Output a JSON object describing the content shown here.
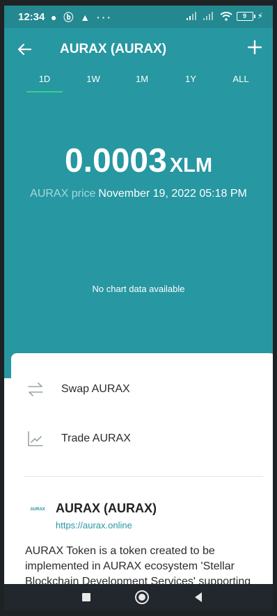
{
  "status_bar": {
    "time": "12:34",
    "left_icons": "● ⓑ ▲ ···",
    "battery": "9"
  },
  "app_bar": {
    "title": "AURAX (AURAX)",
    "back_icon": "arrow-left-icon",
    "add_icon": "plus-icon"
  },
  "range_tabs": [
    {
      "label": "1D",
      "active": true
    },
    {
      "label": "1W",
      "active": false
    },
    {
      "label": "1M",
      "active": false
    },
    {
      "label": "1Y",
      "active": false
    },
    {
      "label": "ALL",
      "active": false
    }
  ],
  "price": {
    "value": "0.0003",
    "unit": "XLM",
    "label": "AURAX price",
    "date": "November 19, 2022 05:18 PM"
  },
  "chart": {
    "empty_message": "No chart data available"
  },
  "actions": [
    {
      "label": "Swap AURAX",
      "icon": "swap-icon"
    },
    {
      "label": "Trade AURAX",
      "icon": "trade-chart-icon"
    }
  ],
  "token": {
    "logo_text": "AURAX",
    "name": "AURAX (AURAX)",
    "link": "https://aurax.online",
    "description": "AURAX Token is a token created to be implemented in AURAX ecosystem 'Stellar Blockchain Development Services' supporting"
  },
  "colors": {
    "header": "#2797a1",
    "status_bar": "#23888f",
    "tab_underline": "#36d18a",
    "link": "#2797a1"
  }
}
